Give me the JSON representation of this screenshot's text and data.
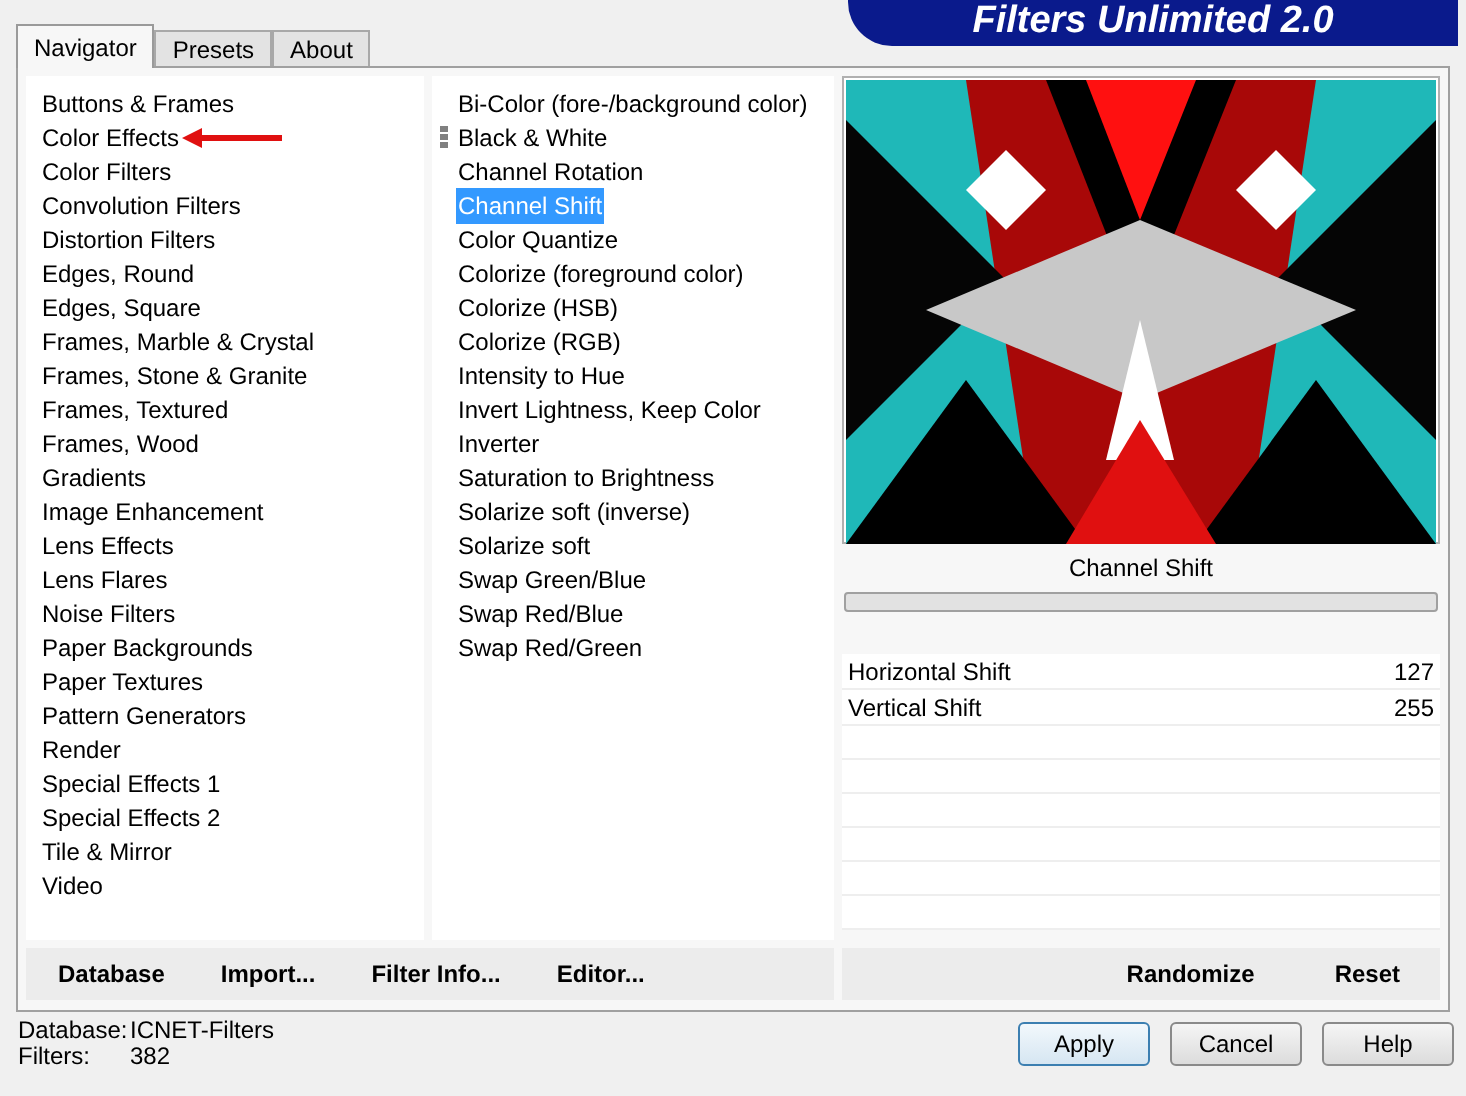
{
  "tabs": [
    {
      "label": "Navigator",
      "selected": true
    },
    {
      "label": "Presets",
      "selected": false
    },
    {
      "label": "About",
      "selected": false
    }
  ],
  "banner": {
    "title": "Filters Unlimited 2.0"
  },
  "categories": [
    {
      "label": "Buttons & Frames",
      "pointed": false
    },
    {
      "label": "Color Effects",
      "pointed": true
    },
    {
      "label": "Color Filters",
      "pointed": false
    },
    {
      "label": "Convolution Filters",
      "pointed": false
    },
    {
      "label": "Distortion Filters",
      "pointed": false
    },
    {
      "label": "Edges, Round",
      "pointed": false
    },
    {
      "label": "Edges, Square",
      "pointed": false
    },
    {
      "label": "Frames, Marble & Crystal",
      "pointed": false
    },
    {
      "label": "Frames, Stone & Granite",
      "pointed": false
    },
    {
      "label": "Frames, Textured",
      "pointed": false
    },
    {
      "label": "Frames, Wood",
      "pointed": false
    },
    {
      "label": "Gradients",
      "pointed": false
    },
    {
      "label": "Image Enhancement",
      "pointed": false
    },
    {
      "label": "Lens Effects",
      "pointed": false
    },
    {
      "label": "Lens Flares",
      "pointed": false
    },
    {
      "label": "Noise Filters",
      "pointed": false
    },
    {
      "label": "Paper Backgrounds",
      "pointed": false
    },
    {
      "label": "Paper Textures",
      "pointed": false
    },
    {
      "label": "Pattern Generators",
      "pointed": false
    },
    {
      "label": "Render",
      "pointed": false
    },
    {
      "label": "Special Effects 1",
      "pointed": false
    },
    {
      "label": "Special Effects 2",
      "pointed": false
    },
    {
      "label": "Tile & Mirror",
      "pointed": false
    },
    {
      "label": "Video",
      "pointed": false
    }
  ],
  "filters": [
    {
      "label": "Bi-Color (fore-/background color)",
      "selected": false,
      "marked": false
    },
    {
      "label": "Black & White",
      "selected": false,
      "marked": true
    },
    {
      "label": "Channel Rotation",
      "selected": false,
      "marked": false
    },
    {
      "label": "Channel Shift",
      "selected": true,
      "marked": false
    },
    {
      "label": "Color Quantize",
      "selected": false,
      "marked": false
    },
    {
      "label": "Colorize (foreground color)",
      "selected": false,
      "marked": false
    },
    {
      "label": "Colorize (HSB)",
      "selected": false,
      "marked": false
    },
    {
      "label": "Colorize (RGB)",
      "selected": false,
      "marked": false
    },
    {
      "label": "Intensity to Hue",
      "selected": false,
      "marked": false
    },
    {
      "label": "Invert Lightness, Keep Color",
      "selected": false,
      "marked": false
    },
    {
      "label": "Inverter",
      "selected": false,
      "marked": false
    },
    {
      "label": "Saturation to Brightness",
      "selected": false,
      "marked": false
    },
    {
      "label": "Solarize soft (inverse)",
      "selected": false,
      "marked": false
    },
    {
      "label": "Solarize soft",
      "selected": false,
      "marked": false
    },
    {
      "label": "Swap Green/Blue",
      "selected": false,
      "marked": false
    },
    {
      "label": "Swap Red/Blue",
      "selected": false,
      "marked": false
    },
    {
      "label": "Swap Red/Green",
      "selected": false,
      "marked": false
    }
  ],
  "preview": {
    "kind": "picture",
    "caption": "Channel Shift"
  },
  "parameters": [
    {
      "name": "Horizontal Shift",
      "value": "127"
    },
    {
      "name": "Vertical Shift",
      "value": "255"
    }
  ],
  "left_toolbar": [
    "Database",
    "Import...",
    "Filter Info...",
    "Editor..."
  ],
  "right_toolbar": [
    "Randomize",
    "Reset"
  ],
  "status": [
    {
      "label": "Database:",
      "value": "ICNET-Filters"
    },
    {
      "label": "Filters:",
      "value": "382"
    }
  ],
  "buttons": [
    {
      "label": "Apply",
      "default": true
    },
    {
      "label": "Cancel",
      "default": false
    },
    {
      "label": "Help",
      "default": false
    }
  ]
}
